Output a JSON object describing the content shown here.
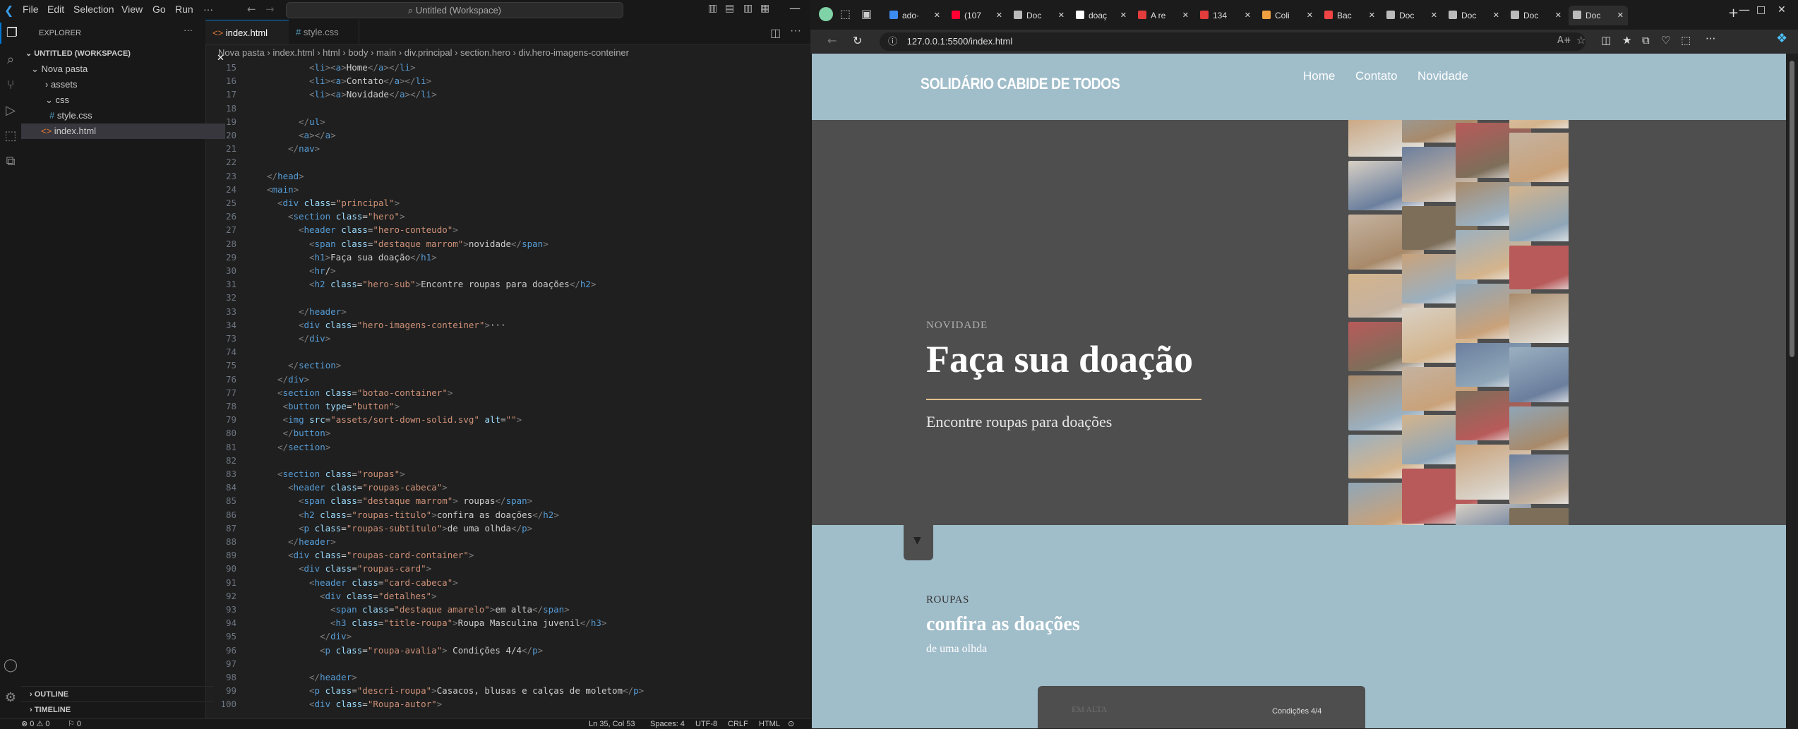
{
  "vscode": {
    "menu": [
      "File",
      "Edit",
      "Selection",
      "View",
      "Go",
      "Run",
      "···"
    ],
    "command_center": "Untitled (Workspace)",
    "explorer": {
      "title": "EXPLORER",
      "workspace": "UNTITLED (WORKSPACE)",
      "items": [
        "Nova pasta",
        "assets",
        "css",
        "style.css",
        "index.html"
      ],
      "outline": "OUTLINE",
      "timeline": "TIMELINE"
    },
    "tabs": [
      "index.html",
      "style.css"
    ],
    "breadcrumb": [
      "Nova pasta",
      "index.html",
      "html",
      "body",
      "main",
      "div.principal",
      "section.hero",
      "div.hero-imagens-conteiner"
    ],
    "code_lines": [
      {
        "n": "15",
        "text": "<li><a>Home</a></li>",
        "indent": 10
      },
      {
        "n": "16",
        "text": "<li><a>Contato</a></li>",
        "indent": 10
      },
      {
        "n": "17",
        "text": "<li><a>Novidade</a></li>",
        "indent": 10
      },
      {
        "n": "18",
        "text": "",
        "indent": 0
      },
      {
        "n": "19",
        "text": "</ul>",
        "indent": 8
      },
      {
        "n": "20",
        "text": "<a></a>",
        "indent": 8
      },
      {
        "n": "21",
        "text": "</nav>",
        "indent": 6
      },
      {
        "n": "22",
        "text": "",
        "indent": 0
      },
      {
        "n": "23",
        "text": "</head>",
        "indent": 2
      },
      {
        "n": "24",
        "text": "<main>",
        "indent": 2
      },
      {
        "n": "25",
        "text": "<div class=\"principal\">",
        "indent": 4
      },
      {
        "n": "26",
        "text": "<section class=\"hero\">",
        "indent": 6
      },
      {
        "n": "27",
        "text": "<header class=\"hero-conteudo\">",
        "indent": 8
      },
      {
        "n": "28",
        "text": "<span class=\"destaque marrom\">novidade</span>",
        "indent": 10
      },
      {
        "n": "29",
        "text": "<h1>Faça sua doação</h1>",
        "indent": 10
      },
      {
        "n": "30",
        "text": "<hr/>",
        "indent": 10
      },
      {
        "n": "31",
        "text": "<h2 class=\"hero-sub\">Encontre roupas para doações</h2>",
        "indent": 10
      },
      {
        "n": "32",
        "text": "",
        "indent": 0
      },
      {
        "n": "33",
        "text": "</header>",
        "indent": 8
      },
      {
        "n": "34",
        "text": "<div class=\"hero-imagens-conteiner\">···",
        "indent": 8
      },
      {
        "n": "73",
        "text": "</div>",
        "indent": 8
      },
      {
        "n": "74",
        "text": "",
        "indent": 0
      },
      {
        "n": "75",
        "text": "</section>",
        "indent": 6
      },
      {
        "n": "76",
        "text": "</div>",
        "indent": 4
      },
      {
        "n": "77",
        "text": "<section class=\"botao-container\">",
        "indent": 4
      },
      {
        "n": "78",
        "text": "<button type=\"button\">",
        "indent": 5
      },
      {
        "n": "79",
        "text": "<img src=\"assets/sort-down-solid.svg\" alt=\"\">",
        "indent": 5
      },
      {
        "n": "80",
        "text": "</button>",
        "indent": 5
      },
      {
        "n": "81",
        "text": "</section>",
        "indent": 4
      },
      {
        "n": "82",
        "text": "",
        "indent": 0
      },
      {
        "n": "83",
        "text": "<section class=\"roupas\">",
        "indent": 4
      },
      {
        "n": "84",
        "text": "<header class=\"roupas-cabeca\">",
        "indent": 6
      },
      {
        "n": "85",
        "text": "<span class=\"destaque marrom\"> roupas</span>",
        "indent": 8
      },
      {
        "n": "86",
        "text": "<h2 class=\"roupas-titulo\">confira as doações</h2>",
        "indent": 8
      },
      {
        "n": "87",
        "text": "<p class=\"roupas-subtitulo\">de uma olhda</p>",
        "indent": 8
      },
      {
        "n": "88",
        "text": "</header>",
        "indent": 6
      },
      {
        "n": "89",
        "text": "<div class=\"roupas-card-container\">",
        "indent": 6
      },
      {
        "n": "90",
        "text": "<div class=\"roupas-card\">",
        "indent": 8
      },
      {
        "n": "91",
        "text": "<header class=\"card-cabeca\">",
        "indent": 10
      },
      {
        "n": "92",
        "text": "<div class=\"detalhes\">",
        "indent": 12
      },
      {
        "n": "93",
        "text": "<span class=\"destaque amarelo\">em alta</span>",
        "indent": 14
      },
      {
        "n": "94",
        "text": "<h3 class=\"title-roupa\">Roupa Masculina juvenil</h3>",
        "indent": 14
      },
      {
        "n": "95",
        "text": "</div>",
        "indent": 12
      },
      {
        "n": "96",
        "text": "<p class=\"roupa-avalia\"> Condições 4/4</p>",
        "indent": 12
      },
      {
        "n": "97",
        "text": "",
        "indent": 0
      },
      {
        "n": "98",
        "text": "</header>",
        "indent": 10
      },
      {
        "n": "99",
        "text": "<p class=\"descri-roupa\">Casacos, blusas e calças de moletom</p>",
        "indent": 10
      },
      {
        "n": "100",
        "text": "<div class=\"Roupa-autor\">",
        "indent": 10
      }
    ],
    "active_line": "35",
    "status": {
      "errors": "⊗ 0 ⚠ 0",
      "ports": "⚐ 0",
      "position": "Ln 35, Col 53",
      "spaces": "Spaces: 4",
      "encoding": "UTF-8",
      "eol": "CRLF",
      "language": "HTML"
    }
  },
  "browser": {
    "tabs": [
      "ado·",
      "(107",
      "Doc",
      "doaç",
      "A re",
      "134",
      "Coli",
      "Bac",
      "Doc",
      "Doc",
      "Doc",
      "Doc"
    ],
    "url": "127.0.0.1:5500/index.html",
    "site": {
      "brand": "SOLIDÁRIO CABIDE DE TODOS",
      "nav": [
        "Home",
        "Contato",
        "Novidade"
      ],
      "hero": {
        "eyebrow": "NOVIDADE",
        "title": "Faça sua doação",
        "subtitle": "Encontre roupas para doações"
      },
      "roupas": {
        "eyebrow": "ROUPAS",
        "title": "confira as doações",
        "subtitle": "de uma olhda"
      },
      "card": {
        "left": "EM ALTA",
        "right": "Condições 4/4"
      }
    }
  }
}
